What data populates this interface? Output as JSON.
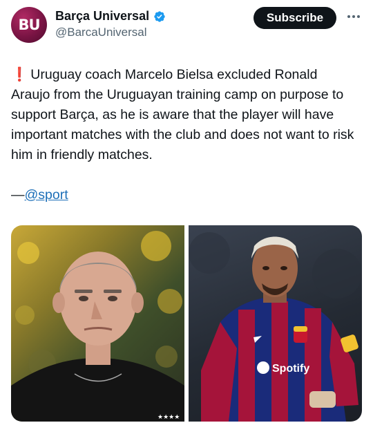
{
  "account": {
    "avatar_text": "BU",
    "display_name": "Barça Universal",
    "handle": "@BarcaUniversal",
    "subscribe_label": "Subscribe",
    "verified": true
  },
  "tweet": {
    "alert_icon": "❗",
    "text": "Uruguay coach Marcelo Bielsa excluded Ronald Araujo from the Uruguayan training camp on purpose to support Barça, as he is aware that the player will have important matches with the club and does not want to risk him in friendly matches.",
    "attribution_dash": "—",
    "attribution_link": "@sport"
  },
  "media": {
    "shirt_sponsor": "Spotify",
    "jersey_stars": "★★★★"
  },
  "colors": {
    "avatar": "#7a1444",
    "verified": "#1d9bf0",
    "link": "#1d6fb8",
    "subscribe_bg": "#0f1419"
  }
}
